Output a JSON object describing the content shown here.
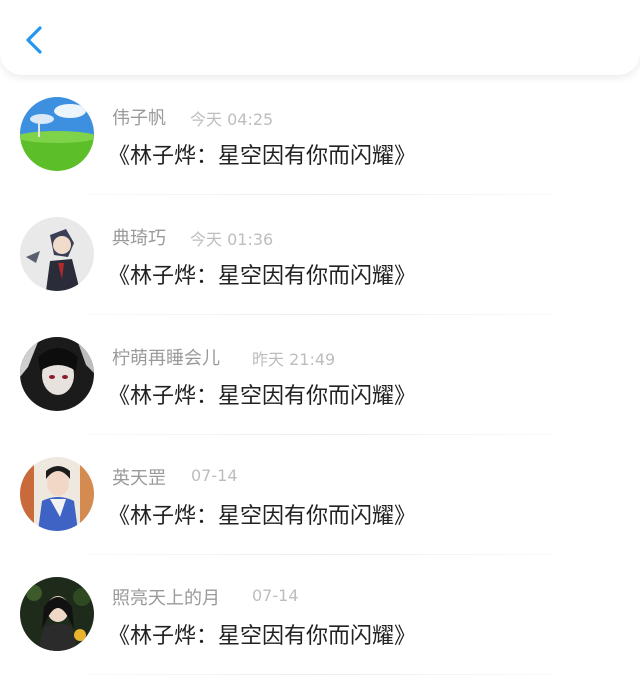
{
  "header": {
    "back_icon": "chevron-left-icon",
    "accent_color": "#2196F3"
  },
  "comments": [
    {
      "name": "伟子帆",
      "time": "今天 04:25",
      "message": "《林子烨：星空因有你而闪耀》"
    },
    {
      "name": "典琦巧",
      "time": "今天 01:36",
      "message": "《林子烨：星空因有你而闪耀》"
    },
    {
      "name": "柠萌再睡会儿",
      "time": "昨天 21:49",
      "message": "《林子烨：星空因有你而闪耀》"
    },
    {
      "name": "英天罡",
      "time": "07-14",
      "message": "《林子烨：星空因有你而闪耀》"
    },
    {
      "name": "照亮天上的月",
      "time": "07-14",
      "message": "《林子烨：星空因有你而闪耀》"
    }
  ]
}
